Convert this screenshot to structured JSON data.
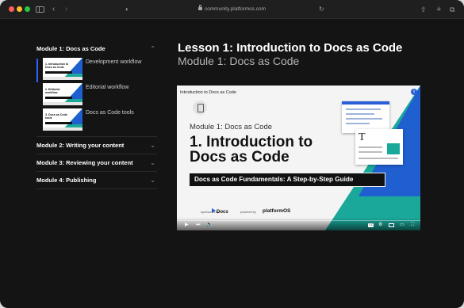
{
  "browser": {
    "url": "community.platformos.com"
  },
  "sidebar": {
    "open_module": {
      "title": "Module 1: Docs as Code",
      "lessons": [
        {
          "label": "Development workflow",
          "thumb_title": "1. Introduction to Docs as Code"
        },
        {
          "label": "Editorial workflow",
          "thumb_title": "2. Editorial workflow"
        },
        {
          "label": "Docs as Code tools",
          "thumb_title": "3. Docs as Code tools"
        }
      ]
    },
    "modules": [
      {
        "title": "Module 2: Writing your content"
      },
      {
        "title": "Module 3: Reviewing your content"
      },
      {
        "title": "Module 4: Publishing"
      }
    ]
  },
  "main": {
    "lesson_title": "Lesson 1: Introduction to Docs as Code",
    "module_subtitle": "Module 1: Docs as Code",
    "video": {
      "top_title": "Introduction to Docs as Code",
      "info": "i",
      "module": "Module 1: Docs as Code",
      "title": "1. Introduction to Docs as Code",
      "banner": "Docs as Code Fundamentals: A Step-by-Step Guide",
      "sponsored_by": "sponsored by",
      "sponsor": "Docs",
      "powered_by": "powered by",
      "powered": "platformOS",
      "cc": "CC",
      "progress": 0
    }
  },
  "colors": {
    "accent_blue": "#1f5fd0",
    "accent_teal": "#1aa89a",
    "selected_bar": "#2f62ff"
  }
}
